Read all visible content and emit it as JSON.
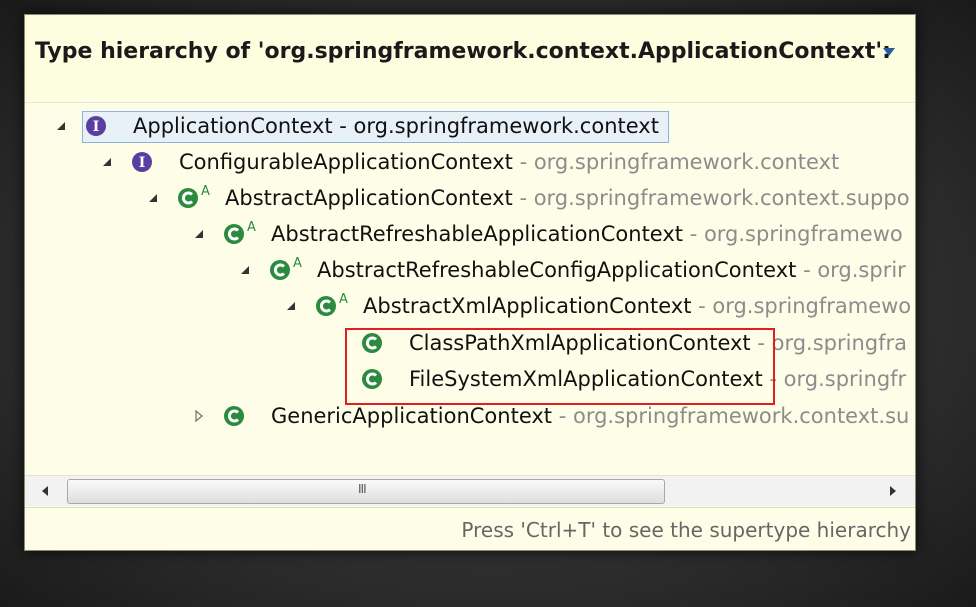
{
  "header": {
    "title": "Type hierarchy of 'org.springframework.context.ApplicationContext':"
  },
  "tree": [
    {
      "name": "ApplicationContext",
      "pkg": " - org.springframework.context",
      "kind": "interface",
      "expanded": true,
      "selected": true
    },
    {
      "name": "ConfigurableApplicationContext",
      "pkg": " - org.springframework.context",
      "kind": "interface",
      "expanded": true
    },
    {
      "name": "AbstractApplicationContext",
      "pkg": " - org.springframework.context.suppo",
      "kind": "abstract-class",
      "expanded": true
    },
    {
      "name": "AbstractRefreshableApplicationContext",
      "pkg": " - org.springframewo",
      "kind": "abstract-class",
      "expanded": true
    },
    {
      "name": "AbstractRefreshableConfigApplicationContext",
      "pkg": " - org.sprir",
      "kind": "abstract-class",
      "expanded": true
    },
    {
      "name": "AbstractXmlApplicationContext",
      "pkg": " - org.springframewo",
      "kind": "abstract-class",
      "expanded": true
    },
    {
      "name": "ClassPathXmlApplicationContext",
      "pkg": " - org.springfra",
      "kind": "class"
    },
    {
      "name": "FileSystemXmlApplicationContext",
      "pkg": " - org.springfr",
      "kind": "class"
    },
    {
      "name": "GenericApplicationContext",
      "pkg": " - org.springframework.context.su",
      "kind": "class",
      "expanded": false
    }
  ],
  "scrollbar": {
    "grip": "III"
  },
  "status": {
    "text": "Press 'Ctrl+T' to see the supertype hierarchy"
  },
  "colors": {
    "popup_bg": "#fefee8",
    "highlight": "#e02020",
    "interface_icon": "#5a3fa0",
    "class_icon": "#2b8a3e"
  },
  "icons": {
    "interface": "interface-icon",
    "abstract-class": "abstract-class-icon",
    "class": "class-icon",
    "expanded": "expanded-triangle-icon",
    "collapsed": "collapsed-triangle-icon",
    "menu": "view-menu-icon"
  }
}
